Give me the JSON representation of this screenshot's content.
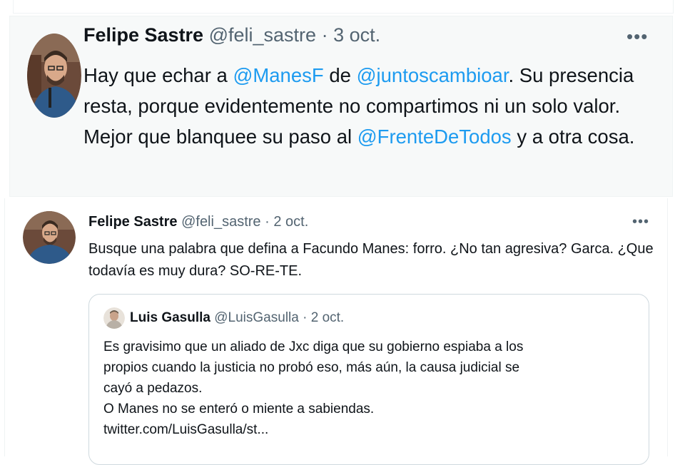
{
  "tweet1": {
    "name": "Felipe Sastre",
    "handle": "@feli_sastre",
    "sep": " · ",
    "date": "3 oct.",
    "more": "•••",
    "text": {
      "t1": "Hay que echar a ",
      "m1": "@ManesF",
      "t2": " de ",
      "m2": "@juntoscambioar",
      "t3": ". Su presencia resta, porque evidentemente no compartimos ni un solo valor. Mejor que blanquee su paso al ",
      "m3": "@FrenteDeTodos",
      "t4": " y a otra cosa."
    }
  },
  "tweet2": {
    "name": "Felipe Sastre",
    "handle": "@feli_sastre",
    "sep": " · ",
    "date": "2 oct.",
    "more": "•••",
    "text": "Busque una palabra que defina a Facundo Manes: forro. ¿No tan agresiva? Garca. ¿Que todavía es muy dura? SO-RE-TE."
  },
  "quoted": {
    "name": "Luis Gasulla",
    "handle": "@LuisGasulla",
    "sep": " · ",
    "date": "2 oct.",
    "lines": [
      "Es gravisimo que un aliado de Jxc diga que su gobierno espiaba a los",
      "propios cuando la justicia no probó eso, más aún, la causa judicial se",
      "cayó a pedazos.",
      "O Manes no se enteró o miente a sabiendas.",
      "twitter.com/LuisGasulla/st..."
    ]
  },
  "colors": {
    "mention": "#1d9bf0",
    "secondary_text": "#536471",
    "card_bg": "#f7f9f9"
  },
  "icons": {
    "more": "more-horizontal-icon",
    "avatar": "user-avatar"
  }
}
